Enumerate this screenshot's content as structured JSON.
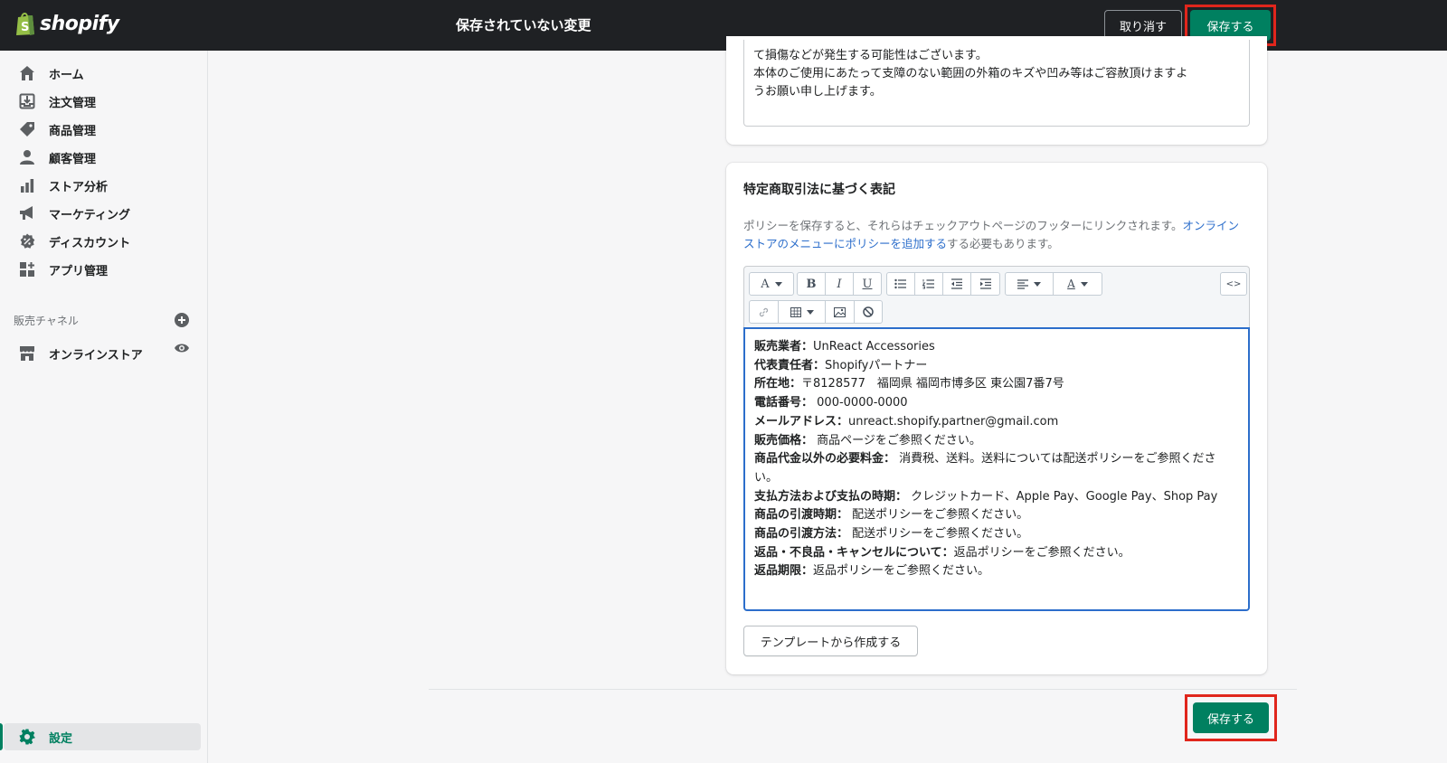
{
  "topbar": {
    "logo_text": "shopify",
    "title": "保存されていない変更",
    "discard_label": "取り消す",
    "save_label": "保存する"
  },
  "sidebar": {
    "items": [
      {
        "label": "ホーム",
        "icon": "home-icon"
      },
      {
        "label": "注文管理",
        "icon": "orders-icon"
      },
      {
        "label": "商品管理",
        "icon": "tag-icon"
      },
      {
        "label": "顧客管理",
        "icon": "customer-icon"
      },
      {
        "label": "ストア分析",
        "icon": "analytics-icon"
      },
      {
        "label": "マーケティング",
        "icon": "megaphone-icon"
      },
      {
        "label": "ディスカウント",
        "icon": "discount-icon"
      },
      {
        "label": "アプリ管理",
        "icon": "apps-icon"
      }
    ],
    "channels_header": "販売チャネル",
    "channel_online_store": "オンラインストア",
    "settings_label": "設定"
  },
  "prev_card": {
    "lines": [
      "て損傷などが発生する可能性はございます。",
      "本体のご使用にあたって支障のない範囲の外箱のキズや凹み等はご容赦頂けますよ",
      "うお願い申し上げます。"
    ]
  },
  "legal_card": {
    "title": "特定商取引法に基づく表記",
    "help_prefix": "ポリシーを保存すると、それらはチェックアウトページのフッターにリンクされます。",
    "help_link": "オンラインストアのメニューにポリシーを追加する",
    "help_suffix": "する必要もあります。",
    "toolbar": {
      "font": "A",
      "bold": "B",
      "italic": "I",
      "underline": "U",
      "color": "A",
      "code": "<>"
    },
    "content": [
      {
        "label": "販売業者：",
        "value": "UnReact Accessories"
      },
      {
        "label": "代表責任者：",
        "value": "Shopifyパートナー"
      },
      {
        "label": "所在地：",
        "value": "〒8128577　福岡県 福岡市博多区 東公園7番7号"
      },
      {
        "label": "電話番号：",
        "value": " 000-0000-0000"
      },
      {
        "label": "メールアドレス：",
        "value": "unreact.shopify.partner@gmail.com"
      },
      {
        "label": "販売価格：",
        "value": " 商品ページをご参照ください。"
      },
      {
        "label": "商品代金以外の必要料金：",
        "value": " 消費税、送料。送料については配送ポリシーをご参照ください。"
      },
      {
        "label": "支払方法および支払の時期：",
        "value": " クレジットカード、Apple Pay、Google Pay、Shop Pay"
      },
      {
        "label": "商品の引渡時期：",
        "value": " 配送ポリシーをご参照ください。"
      },
      {
        "label": "商品の引渡方法：",
        "value": " 配送ポリシーをご参照ください。"
      },
      {
        "label": "返品・不良品・キャンセルについて：",
        "value": "返品ポリシーをご参照ください。"
      },
      {
        "label": "返品期限：",
        "value": "返品ポリシーをご参照ください。"
      }
    ],
    "template_button": "テンプレートから作成する"
  },
  "footer": {
    "save_label": "保存する"
  },
  "colors": {
    "topbar": "#1f2124",
    "primary": "#008060",
    "highlight": "#e0261c",
    "link": "#2c6ecb"
  }
}
